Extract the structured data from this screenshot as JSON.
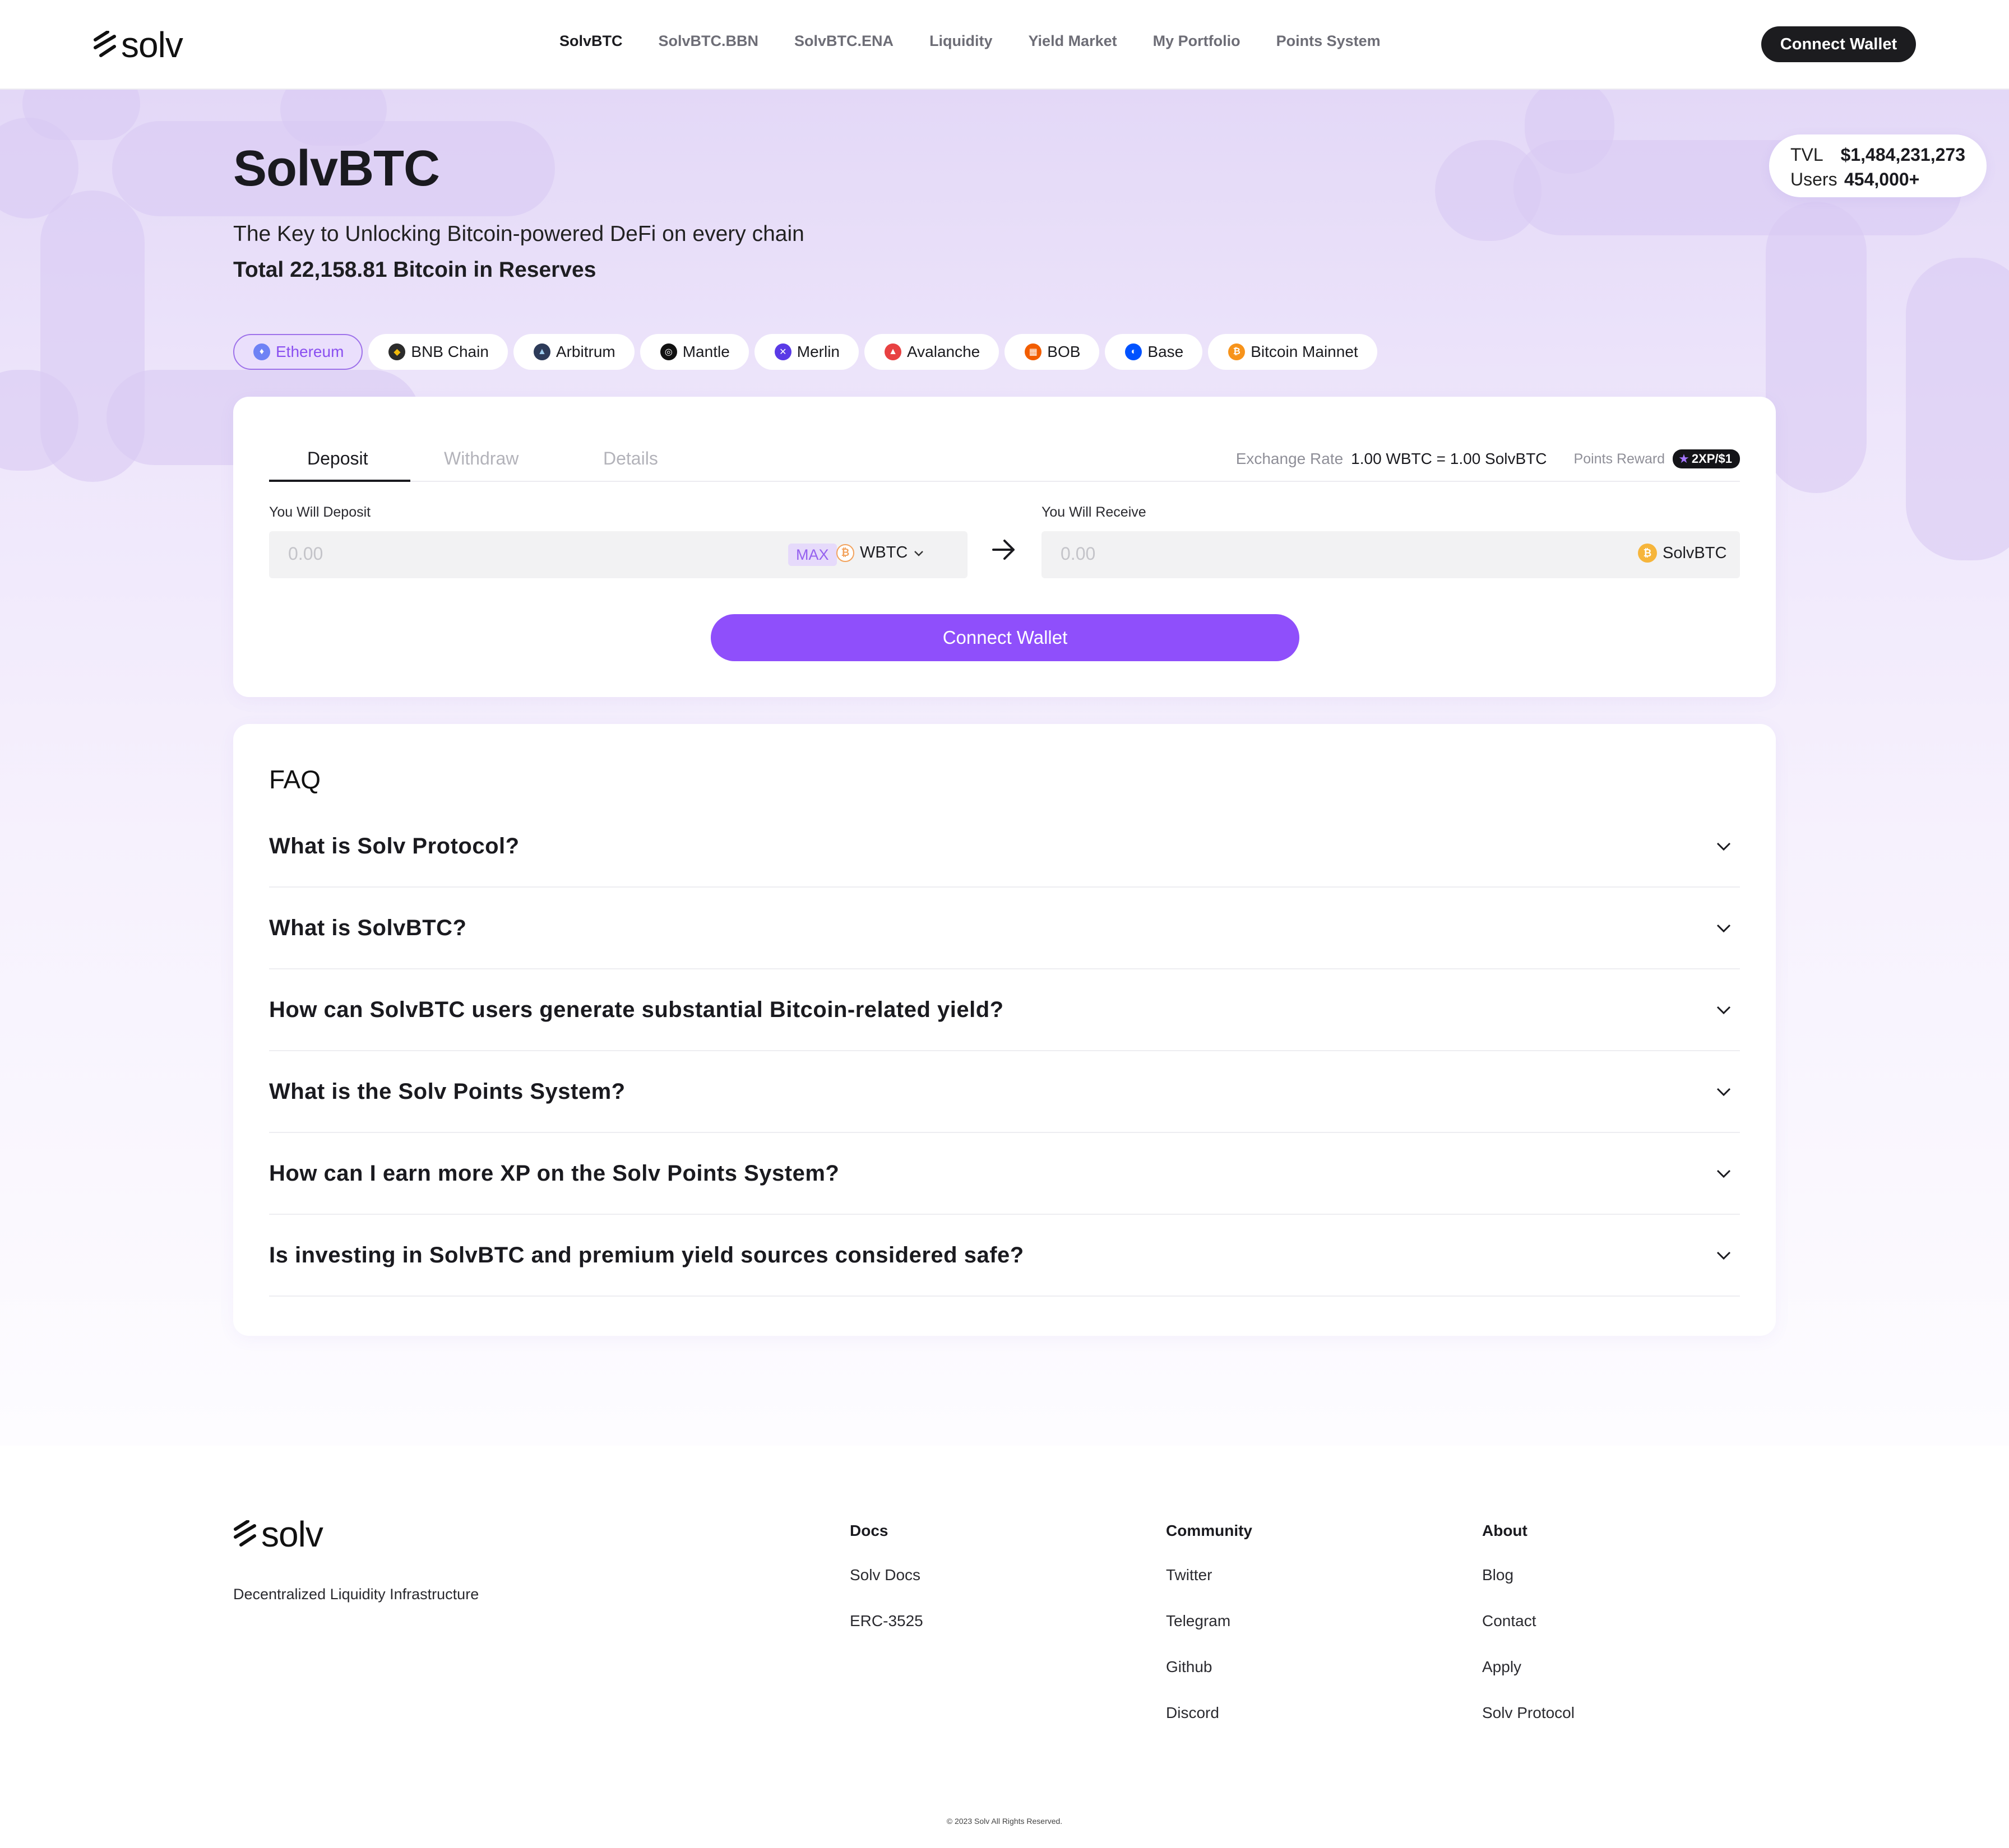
{
  "header": {
    "logo_text": "solv",
    "nav": [
      {
        "label": "SolvBTC",
        "active": true
      },
      {
        "label": "SolvBTC.BBN",
        "active": false
      },
      {
        "label": "SolvBTC.ENA",
        "active": false
      },
      {
        "label": "Liquidity",
        "active": false
      },
      {
        "label": "Yield Market",
        "active": false
      },
      {
        "label": "My Portfolio",
        "active": false
      },
      {
        "label": "Points System",
        "active": false
      }
    ],
    "connect_label": "Connect Wallet"
  },
  "hero": {
    "title": "SolvBTC",
    "subtitle": "The Key to Unlocking Bitcoin-powered DeFi on every chain",
    "total": "Total 22,158.81 Bitcoin in Reserves"
  },
  "stats": {
    "tvl_label": "TVL",
    "tvl_value": "$1,484,231,273",
    "users_label": "Users",
    "users_value": "454,000+"
  },
  "chains": [
    {
      "label": "Ethereum",
      "active": true,
      "icon": "ethereum-icon",
      "color": "#6e82f5"
    },
    {
      "label": "BNB Chain",
      "active": false,
      "icon": "bnb-icon",
      "color": "#2b2b2b"
    },
    {
      "label": "Arbitrum",
      "active": false,
      "icon": "arbitrum-icon",
      "color": "#2d3b59"
    },
    {
      "label": "Mantle",
      "active": false,
      "icon": "mantle-icon",
      "color": "#111111"
    },
    {
      "label": "Merlin",
      "active": false,
      "icon": "merlin-icon",
      "color": "#5a3ae6"
    },
    {
      "label": "Avalanche",
      "active": false,
      "icon": "avalanche-icon",
      "color": "#e84142"
    },
    {
      "label": "BOB",
      "active": false,
      "icon": "bob-icon",
      "color": "#f25d00"
    },
    {
      "label": "Base",
      "active": false,
      "icon": "base-icon",
      "color": "#0052ff"
    },
    {
      "label": "Bitcoin Mainnet",
      "active": false,
      "icon": "bitcoin-icon",
      "color": "#f7931a"
    }
  ],
  "deposit": {
    "tabs": [
      "Deposit",
      "Withdraw",
      "Details"
    ],
    "exchange_label": "Exchange Rate",
    "exchange_value": "1.00 WBTC = 1.00 SolvBTC",
    "points_label": "Points Reward",
    "points_badge": "2XP/$1",
    "deposit_label": "You Will Deposit",
    "deposit_placeholder": "0.00",
    "max_label": "MAX",
    "deposit_token": "WBTC",
    "receive_label": "You Will Receive",
    "receive_placeholder": "0.00",
    "receive_token": "SolvBTC",
    "cta_label": "Connect Wallet"
  },
  "faq": {
    "title": "FAQ",
    "items": [
      "What is Solv Protocol?",
      "What is SolvBTC?",
      "How can SolvBTC users generate substantial Bitcoin-related yield?",
      "What is the Solv Points System?",
      "How can I earn more XP on the Solv Points System?",
      "Is investing in SolvBTC and premium yield sources considered safe?"
    ]
  },
  "footer": {
    "logo_text": "solv",
    "tagline": "Decentralized Liquidity Infrastructure",
    "columns": [
      {
        "title": "Docs",
        "links": [
          "Solv Docs",
          "ERC-3525"
        ]
      },
      {
        "title": "Community",
        "links": [
          "Twitter",
          "Telegram",
          "Github",
          "Discord"
        ]
      },
      {
        "title": "About",
        "links": [
          "Blog",
          "Contact",
          "Apply",
          "Solv Protocol"
        ]
      }
    ],
    "copyright": "© 2023 Solv All Rights Reserved."
  },
  "colors": {
    "accent": "#8f4ffb",
    "dark": "#1c1c1f",
    "hero_tint": "#e3d8f7"
  }
}
